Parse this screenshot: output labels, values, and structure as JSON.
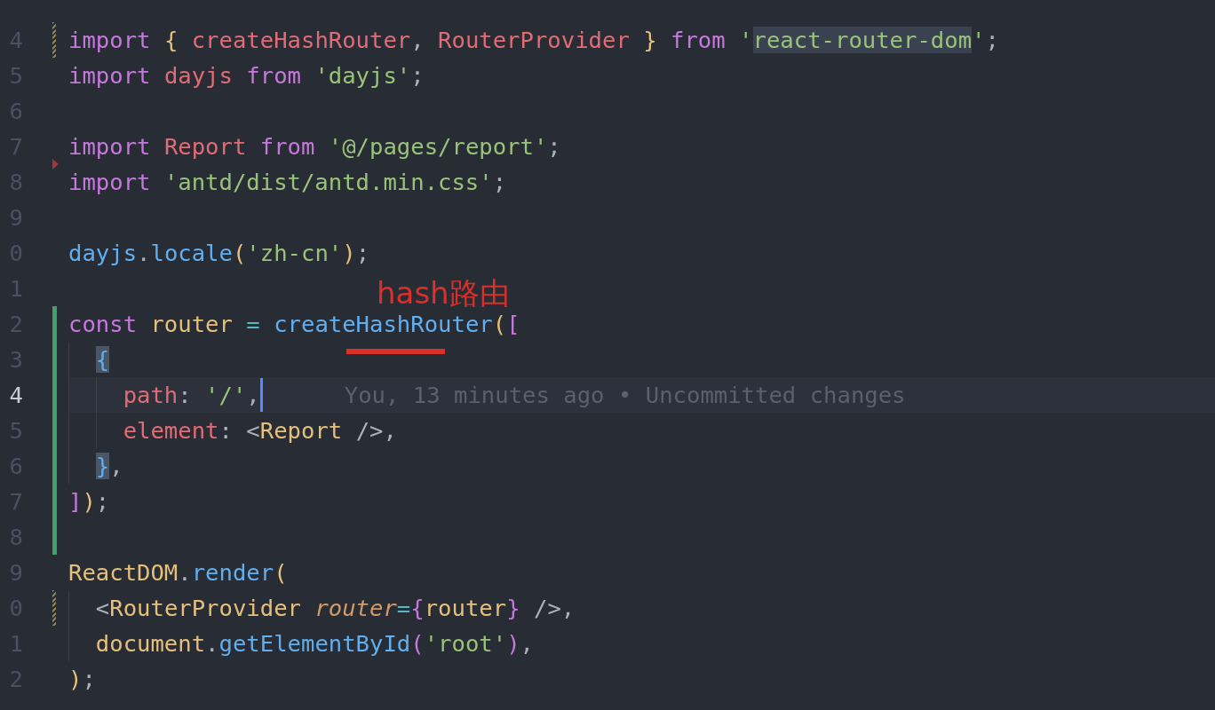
{
  "editor": {
    "lines": [
      {
        "number": "4",
        "modified": true,
        "added": false,
        "deleted": false,
        "current": false,
        "tokens": [
          {
            "kind": "keyword",
            "text": "import "
          },
          {
            "kind": "brace1",
            "text": "{ "
          },
          {
            "kind": "name",
            "text": "createHashRouter"
          },
          {
            "kind": "punct",
            "text": ", "
          },
          {
            "kind": "name",
            "text": "RouterProvider "
          },
          {
            "kind": "brace1",
            "text": "} "
          },
          {
            "kind": "keyword",
            "text": "from "
          },
          {
            "kind": "string",
            "text": "'"
          },
          {
            "kind": "string-selected",
            "text": "react-router-dom"
          },
          {
            "kind": "string",
            "text": "'"
          },
          {
            "kind": "punct",
            "text": ";"
          }
        ]
      },
      {
        "number": "5",
        "modified": false,
        "added": false,
        "deleted": false,
        "current": false,
        "tokens": [
          {
            "kind": "keyword",
            "text": "import "
          },
          {
            "kind": "name",
            "text": "dayjs "
          },
          {
            "kind": "keyword",
            "text": "from "
          },
          {
            "kind": "string",
            "text": "'dayjs'"
          },
          {
            "kind": "punct",
            "text": ";"
          }
        ]
      },
      {
        "number": "6",
        "modified": false,
        "added": false,
        "deleted": false,
        "current": false
      },
      {
        "number": "7",
        "modified": false,
        "added": false,
        "deleted": false,
        "current": false,
        "tokens": [
          {
            "kind": "keyword",
            "text": "import "
          },
          {
            "kind": "name",
            "text": "Report "
          },
          {
            "kind": "keyword",
            "text": "from "
          },
          {
            "kind": "string",
            "text": "'@/pages/report'"
          },
          {
            "kind": "punct",
            "text": ";"
          }
        ]
      },
      {
        "number": "8",
        "modified": false,
        "added": false,
        "deleted": true,
        "current": false,
        "tokens": [
          {
            "kind": "keyword",
            "text": "import "
          },
          {
            "kind": "string",
            "text": "'antd/dist/antd.min.css'"
          },
          {
            "kind": "punct",
            "text": ";"
          }
        ]
      },
      {
        "number": "9",
        "modified": false,
        "added": false,
        "deleted": false,
        "current": false
      },
      {
        "number": "0",
        "modified": false,
        "added": false,
        "deleted": false,
        "current": false,
        "tokens": [
          {
            "kind": "func",
            "text": "dayjs"
          },
          {
            "kind": "punct",
            "text": "."
          },
          {
            "kind": "func",
            "text": "locale"
          },
          {
            "kind": "brace1",
            "text": "("
          },
          {
            "kind": "string",
            "text": "'zh-cn'"
          },
          {
            "kind": "brace1",
            "text": ")"
          },
          {
            "kind": "punct",
            "text": ";"
          }
        ]
      },
      {
        "number": "1",
        "modified": false,
        "added": false,
        "deleted": false,
        "current": false
      },
      {
        "number": "2",
        "modified": false,
        "added": true,
        "deleted": false,
        "current": false,
        "tokens": [
          {
            "kind": "keyword",
            "text": "const "
          },
          {
            "kind": "type",
            "text": "router "
          },
          {
            "kind": "operator",
            "text": "= "
          },
          {
            "kind": "func",
            "text": "createHashRouter"
          },
          {
            "kind": "brace1",
            "text": "("
          },
          {
            "kind": "brace2",
            "text": "["
          }
        ]
      },
      {
        "number": "3",
        "modified": false,
        "added": true,
        "deleted": false,
        "current": false,
        "tokens": [
          {
            "kind": "brace3-matched",
            "text": "  {"
          }
        ]
      },
      {
        "number": "4",
        "modified": false,
        "added": true,
        "deleted": false,
        "current": true,
        "blame": "You, 13 minutes ago • Uncommitted changes",
        "tokens": [
          {
            "kind": "name",
            "text": "    path"
          },
          {
            "kind": "punct",
            "text": ": "
          },
          {
            "kind": "string",
            "text": "'/'"
          },
          {
            "kind": "punct",
            "text": ","
          }
        ]
      },
      {
        "number": "5",
        "modified": false,
        "added": true,
        "deleted": false,
        "current": false,
        "tokens": [
          {
            "kind": "name",
            "text": "    element"
          },
          {
            "kind": "punct",
            "text": ": <"
          },
          {
            "kind": "type",
            "text": "Report"
          },
          {
            "kind": "punct",
            "text": " />,"
          }
        ]
      },
      {
        "number": "6",
        "modified": false,
        "added": true,
        "deleted": false,
        "current": false,
        "tokens": [
          {
            "kind": "brace3-matched",
            "text": "  }"
          },
          {
            "kind": "punct",
            "text": ","
          }
        ]
      },
      {
        "number": "7",
        "modified": false,
        "added": true,
        "deleted": false,
        "current": false,
        "tokens": [
          {
            "kind": "brace2",
            "text": "]"
          },
          {
            "kind": "brace1",
            "text": ")"
          },
          {
            "kind": "punct",
            "text": ";"
          }
        ]
      },
      {
        "number": "8",
        "modified": false,
        "added": true,
        "deleted": false,
        "current": false
      },
      {
        "number": "9",
        "modified": false,
        "added": false,
        "deleted": false,
        "current": false,
        "tokens": [
          {
            "kind": "type",
            "text": "ReactDOM"
          },
          {
            "kind": "punct",
            "text": "."
          },
          {
            "kind": "func",
            "text": "render"
          },
          {
            "kind": "brace1",
            "text": "("
          }
        ]
      },
      {
        "number": "0",
        "modified": true,
        "added": false,
        "deleted": false,
        "current": false,
        "tokens": [
          {
            "kind": "punct",
            "text": "  <"
          },
          {
            "kind": "type",
            "text": "RouterProvider "
          },
          {
            "kind": "attr",
            "text": "router"
          },
          {
            "kind": "operator",
            "text": "="
          },
          {
            "kind": "brace2",
            "text": "{"
          },
          {
            "kind": "type",
            "text": "router"
          },
          {
            "kind": "brace2",
            "text": "}"
          },
          {
            "kind": "punct",
            "text": " />,"
          }
        ]
      },
      {
        "number": "1",
        "modified": false,
        "added": false,
        "deleted": false,
        "current": false,
        "tokens": [
          {
            "kind": "type",
            "text": "  document"
          },
          {
            "kind": "punct",
            "text": "."
          },
          {
            "kind": "func",
            "text": "getElementById"
          },
          {
            "kind": "brace2",
            "text": "("
          },
          {
            "kind": "string",
            "text": "'root'"
          },
          {
            "kind": "brace2",
            "text": ")"
          },
          {
            "kind": "punct",
            "text": ","
          }
        ]
      },
      {
        "number": "2",
        "modified": false,
        "added": false,
        "deleted": false,
        "current": false,
        "tokens": [
          {
            "kind": "brace1",
            "text": ")"
          },
          {
            "kind": "punct",
            "text": ";"
          }
        ]
      }
    ]
  },
  "annotation": {
    "text": "hash路由"
  }
}
